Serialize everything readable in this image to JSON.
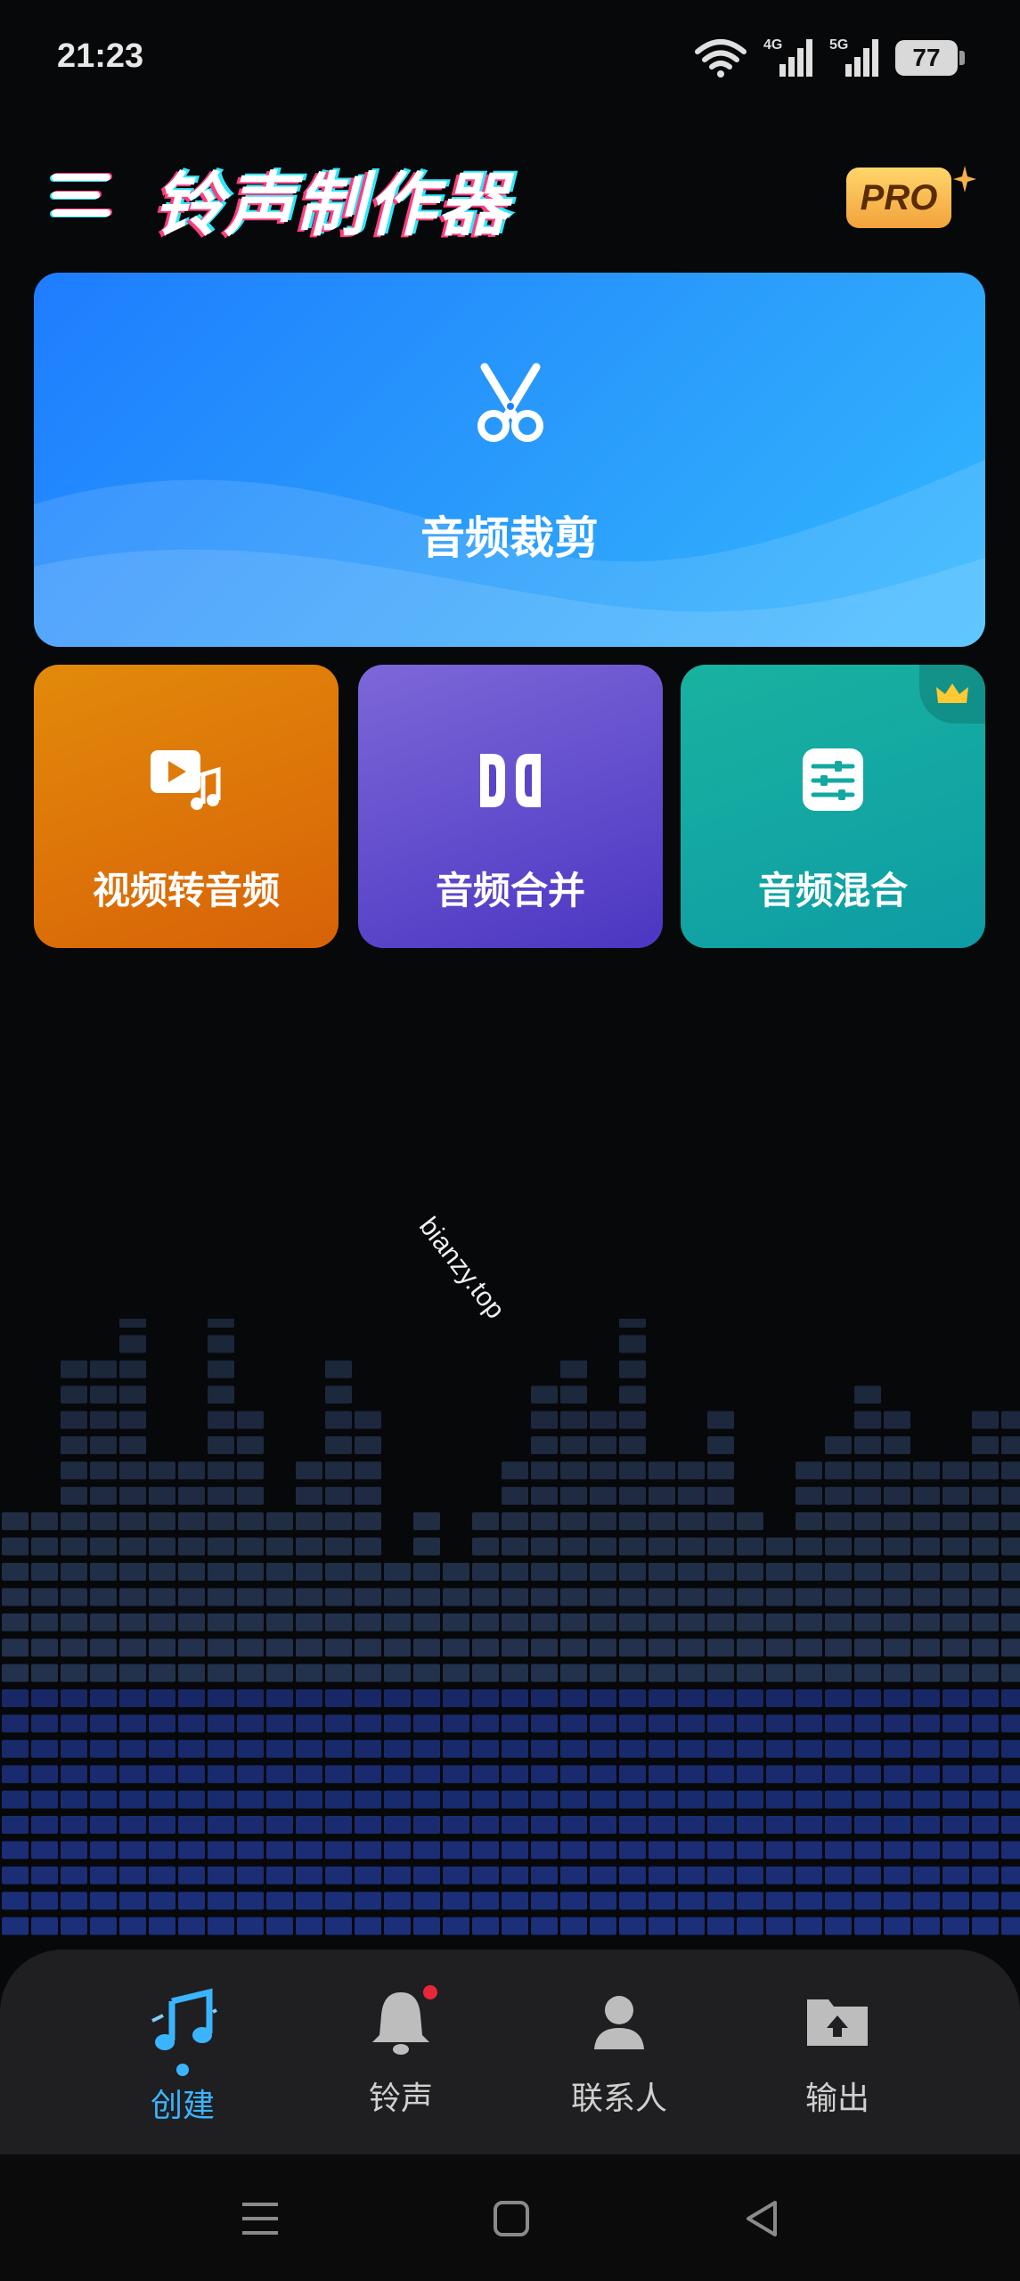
{
  "status_bar": {
    "time": "21:23",
    "signal_1_label": "4G",
    "signal_2_label": "5G",
    "battery": "77",
    "icons": [
      "wifi-icon",
      "signal-4g-icon",
      "signal-5g-icon",
      "battery-icon"
    ]
  },
  "header": {
    "title": "铃声制作器",
    "pro_badge": "PRO"
  },
  "tools": {
    "main": {
      "label": "音频裁剪",
      "icon": "scissors-icon"
    },
    "items": [
      {
        "label": "视频转音频",
        "icon": "video-music-icon"
      },
      {
        "label": "音频合并",
        "icon": "merge-icon"
      },
      {
        "label": "音频混合",
        "icon": "mixer-icon",
        "premium": "crown-icon"
      }
    ]
  },
  "watermark": "bianzy.top",
  "bottom_nav": {
    "items": [
      {
        "label": "创建",
        "icon": "music-note-icon",
        "active": true
      },
      {
        "label": "铃声",
        "icon": "bell-icon",
        "has_badge": true
      },
      {
        "label": "联系人",
        "icon": "contact-icon"
      },
      {
        "label": "输出",
        "icon": "folder-upload-icon"
      }
    ]
  },
  "colors": {
    "background": "#07080a",
    "accent": "#3bb4ff",
    "main_card": "#1e7dff",
    "video_card": "#e07a0a",
    "merge_card": "#6a52cf",
    "mix_card": "#14a8a2",
    "pro": "#f3a23b",
    "badge": "#e8283a"
  }
}
